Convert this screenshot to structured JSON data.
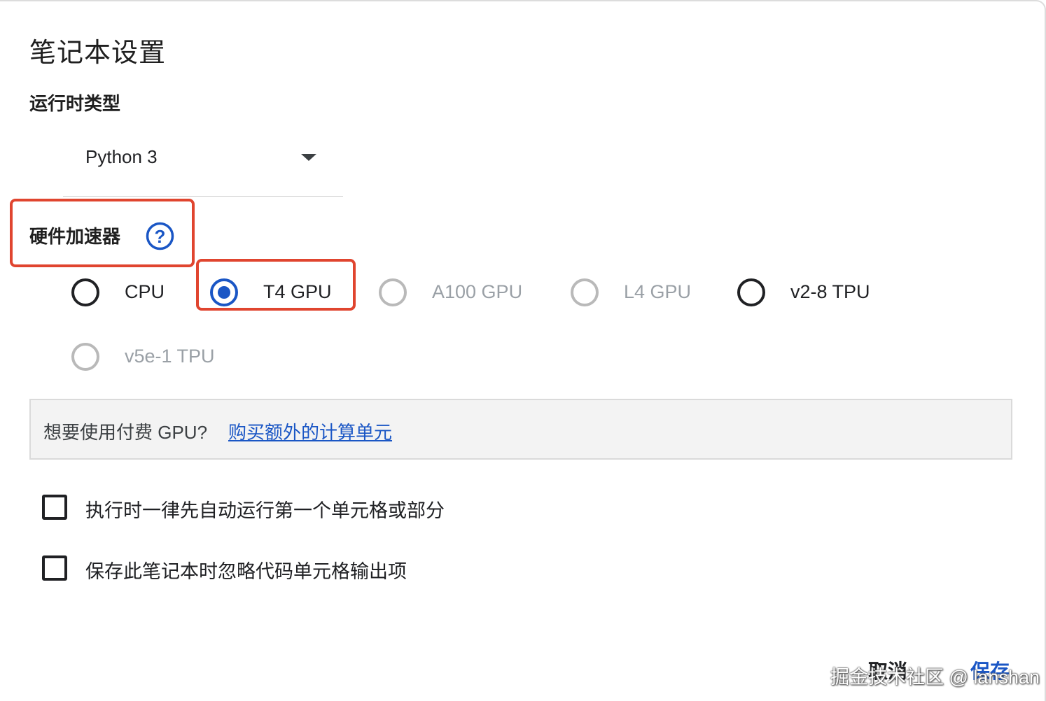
{
  "dialog": {
    "title": "笔记本设置",
    "runtime": {
      "label": "运行时类型",
      "selected": "Python 3"
    },
    "hardware": {
      "label": "硬件加速器",
      "help_icon": "help-circle-icon",
      "options": [
        {
          "label": "CPU",
          "checked": false,
          "disabled": false
        },
        {
          "label": "T4 GPU",
          "checked": true,
          "disabled": false
        },
        {
          "label": "A100 GPU",
          "checked": false,
          "disabled": true
        },
        {
          "label": "L4 GPU",
          "checked": false,
          "disabled": true
        },
        {
          "label": "v2-8 TPU",
          "checked": false,
          "disabled": false
        },
        {
          "label": "v5e-1 TPU",
          "checked": false,
          "disabled": true
        }
      ]
    },
    "promo": {
      "text": "想要使用付费 GPU?",
      "link": "购买额外的计算单元"
    },
    "checkboxes": [
      {
        "label": "执行时一律先自动运行第一个单元格或部分",
        "checked": false
      },
      {
        "label": "保存此笔记本时忽略代码单元格输出项",
        "checked": false
      }
    ],
    "buttons": {
      "cancel": "取消",
      "save": "保存"
    },
    "watermark": "掘金技术社区 @ lanshan"
  },
  "colors": {
    "accent": "#1a56c5",
    "highlight_box": "#e0452f",
    "disabled_text": "#9aa0a6"
  }
}
